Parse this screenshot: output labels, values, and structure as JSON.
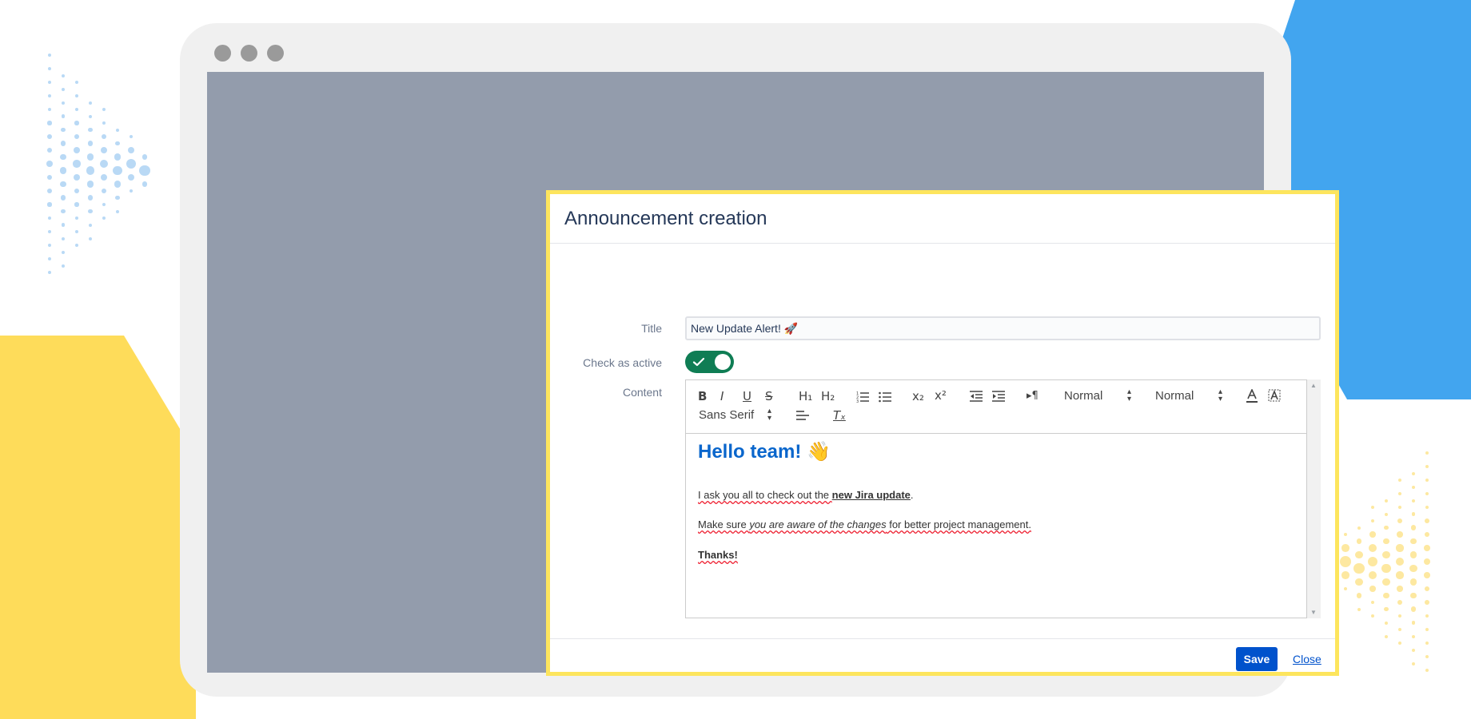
{
  "modal": {
    "title": "Announcement creation"
  },
  "form": {
    "title_label": "Title",
    "title_value": "New Update Alert! 🚀",
    "active_label": "Check as active",
    "active_checked": true,
    "content_label": "Content"
  },
  "toolbar": {
    "bold": "B",
    "italic": "I",
    "underline": "U",
    "strike": "S",
    "h1": "H₁",
    "h2": "H₂",
    "subscript": "x₂",
    "superscript": "x²",
    "direction": "▸¶",
    "header_select": "Normal",
    "size_select": "Normal",
    "font_select": "Sans Serif",
    "clean": "Tₓ"
  },
  "editor": {
    "heading": "Hello team! 👋",
    "line1_prefix": "I ask you all to check out the ",
    "line1_link": "new Jira update",
    "line1_suffix": ".",
    "line2_a": "Make sure ",
    "line2_b": "you are aware of the changes",
    "line2_c": " for better project management.",
    "line3": "Thanks!"
  },
  "footer": {
    "save_label": "Save",
    "close_label": "Close"
  },
  "colors": {
    "primary": "#0052cc",
    "toggle_on": "#0f7d54",
    "modal_border": "#fde55d",
    "heading": "#0a66cc"
  }
}
